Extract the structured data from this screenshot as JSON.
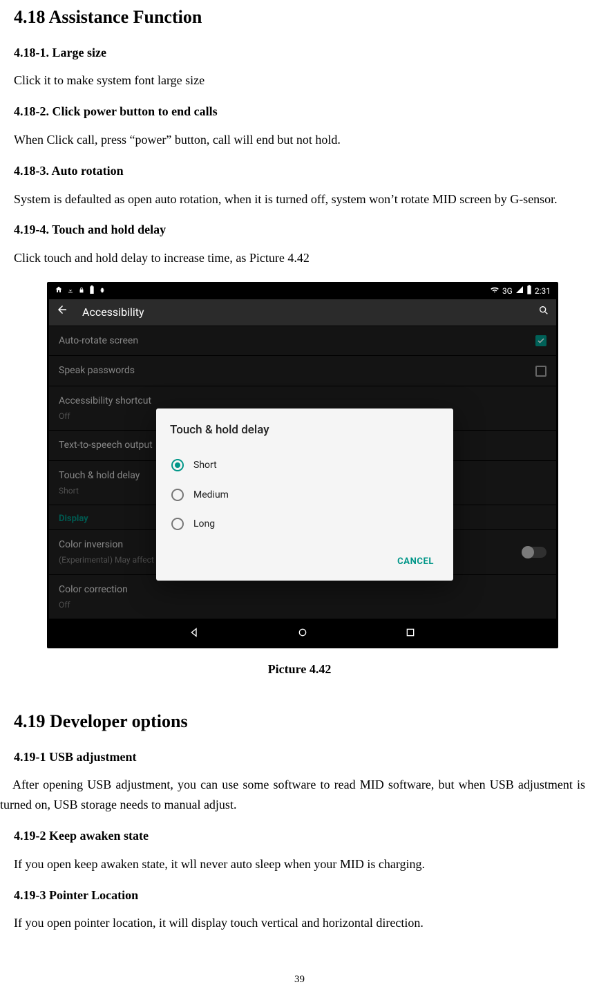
{
  "section418": {
    "title": "4.18 Assistance Function",
    "s1": {
      "heading": "4.18-1. Large size",
      "text": "Click it to make system font large size"
    },
    "s2": {
      "heading": "4.18-2. Click power button to end calls",
      "text": "When Click call, press “power” button, call will end but not hold."
    },
    "s3": {
      "heading": "4.18-3. Auto rotation",
      "text": "System is defaulted as open auto rotation, when it is turned off, system won’t rotate MID screen by G-sensor."
    },
    "s4": {
      "heading": "4.19-4. Touch and hold delay",
      "text": "Click touch and hold delay to increase time, as Picture 4.42"
    }
  },
  "figure": {
    "caption": "Picture 4.42",
    "statusbar": {
      "network": "3G",
      "time": "2:31"
    },
    "appbar": {
      "title": "Accessibility"
    },
    "rows": {
      "auto_rotate": {
        "label": "Auto-rotate screen"
      },
      "speak_passwords": {
        "label": "Speak passwords"
      },
      "shortcut": {
        "label": "Accessibility shortcut",
        "sub": "Off"
      },
      "tts": {
        "label": "Text-to-speech output"
      },
      "hold_delay": {
        "label": "Touch & hold delay",
        "sub": "Short"
      },
      "section_display": {
        "label": "Display"
      },
      "color_inv": {
        "label": "Color inversion",
        "sub": "(Experimental) May affect performance"
      },
      "color_corr": {
        "label": "Color correction",
        "sub": "Off"
      }
    },
    "dialog": {
      "title": "Touch & hold delay",
      "options": [
        "Short",
        "Medium",
        "Long"
      ],
      "selected": "Short",
      "cancel": "CANCEL"
    }
  },
  "section419": {
    "title": "4.19 Developer options",
    "s1": {
      "heading": "4.19-1 USB adjustment",
      "text": "After opening USB adjustment, you can use some software to read MID software, but when USB adjustment is turned on, USB storage needs to manual adjust."
    },
    "s2": {
      "heading": "4.19-2 Keep awaken state",
      "text": "If you open keep awaken state, it wll never auto sleep when your MID is charging."
    },
    "s3": {
      "heading": "4.19-3 Pointer Location",
      "text": "If you open pointer location, it will display touch vertical and horizontal direction."
    }
  },
  "page_number": "39"
}
